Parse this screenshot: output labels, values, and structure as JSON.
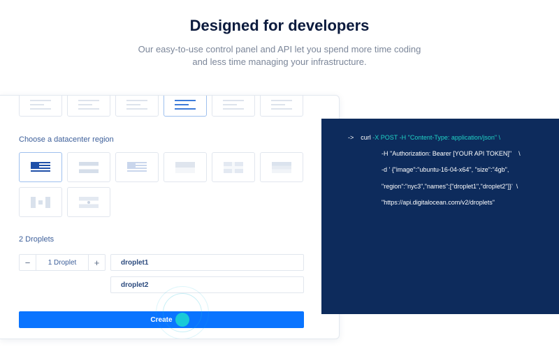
{
  "header": {
    "title": "Designed for developers",
    "subtitle": "Our easy-to-use control panel and API let you spend more time coding and less time managing your infrastructure."
  },
  "control_panel": {
    "size_options": [
      {
        "icon": "size-lines-icon",
        "selected": false
      },
      {
        "icon": "size-lines-icon",
        "selected": false
      },
      {
        "icon": "size-lines-icon",
        "selected": false
      },
      {
        "icon": "size-lines-icon",
        "selected": true
      },
      {
        "icon": "size-lines-icon",
        "selected": false
      },
      {
        "icon": "size-lines-icon",
        "selected": false
      }
    ],
    "region_label": "Choose a datacenter region",
    "regions": [
      {
        "icon": "us-flag-icon",
        "selected": true
      },
      {
        "icon": "netherlands-flag-icon",
        "selected": false
      },
      {
        "icon": "us-flag-icon",
        "selected": false
      },
      {
        "icon": "singapore-flag-icon",
        "selected": false
      },
      {
        "icon": "uk-flag-icon",
        "selected": false
      },
      {
        "icon": "germany-flag-icon",
        "selected": false
      },
      {
        "icon": "canada-flag-icon",
        "selected": false
      },
      {
        "icon": "india-flag-icon",
        "selected": false
      }
    ],
    "droplets_label": "2 Droplets",
    "stepper": {
      "minus": "−",
      "value": "1 Droplet",
      "plus": "+"
    },
    "droplet_names": [
      "droplet1",
      "droplet2"
    ],
    "create_label": "Create"
  },
  "code": {
    "prompt": "->",
    "line1_cmd": "curl",
    "line1_args": " -X POST -H \"Content-Type: application/json\" \\",
    "line2": "-H \"Authorization: Bearer [YOUR API TOKEN]\"    \\",
    "line3": "-d ' {\"image\":\"ubuntu-16-04-x64\", \"size\":\"4gb\",",
    "line4": "\"region\":\"nyc3\",\"names\":[\"droplet1\",\"droplet2\"]}'  \\",
    "line5": "\"https://api.digitalocean.com/v2/droplets\""
  },
  "colors": {
    "accent": "#0a74ff",
    "code_bg": "#0d2b5c",
    "code_highlight": "#20d3c6",
    "heading": "#0b1a3d"
  }
}
